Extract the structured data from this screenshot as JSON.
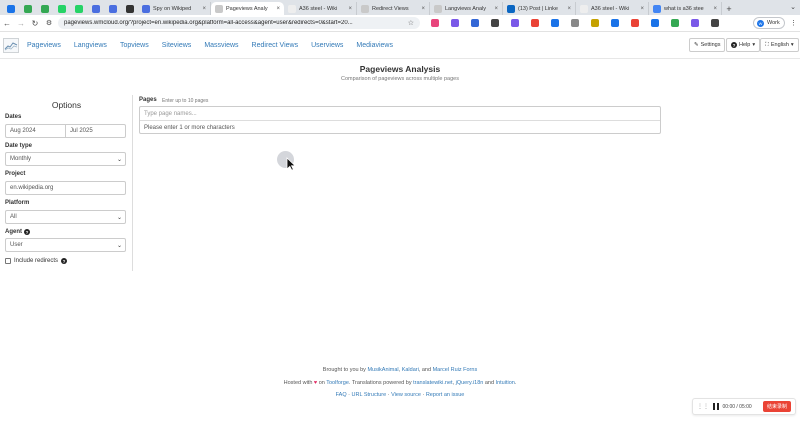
{
  "browser": {
    "tabs": [
      {
        "label": "Spy on Wikiped",
        "favicon_color": "#4a6ee0"
      },
      {
        "label": "Pageviews Analy",
        "favicon_color": "#c9c9c9",
        "active": true
      },
      {
        "label": "A36 steel - Wiki",
        "favicon_color": "#eeeeee"
      },
      {
        "label": "Redirect Views",
        "favicon_color": "#c9c9c9"
      },
      {
        "label": "Langviews Analy",
        "favicon_color": "#c9c9c9"
      },
      {
        "label": "(13) Post | Linke",
        "favicon_color": "#0a66c2"
      },
      {
        "label": "A36 steel - Wiki",
        "favicon_color": "#eeeeee"
      },
      {
        "label": "what is a36 stee",
        "favicon_color": "#4285f4"
      }
    ],
    "pinned_icons": [
      "#1a73e8",
      "#34a853",
      "#34a853",
      "#25d366",
      "#25d366",
      "#4a6ee0",
      "#4a6ee0",
      "#333333"
    ],
    "new_tab_label": "+",
    "menu_label": "⌄",
    "address": "pageviews.wmcloud.org/?project=en.wikipedia.org&platform=all-access&agent=user&redirects=0&start=20...",
    "profile_label": "Work",
    "profile_initial": "W",
    "extension_colors": [
      "#e8457c",
      "#7a59e8",
      "#3367d6",
      "#444444",
      "#7a59e8",
      "#ea4335",
      "#1a73e8",
      "#888888",
      "#c5a100",
      "#1a73e8",
      "#ea4335",
      "#1a73e8",
      "#34a853",
      "#7a59e8",
      "#444444"
    ]
  },
  "site": {
    "nav_links": [
      "Pageviews",
      "Langviews",
      "Topviews",
      "Siteviews",
      "Massviews",
      "Redirect Views",
      "Userviews",
      "Mediaviews"
    ],
    "settings_label": "Settings",
    "help_label": "Help",
    "language_label": "English"
  },
  "main": {
    "title": "Pageviews Analysis",
    "subtitle": "Comparison of pageviews across multiple pages",
    "options": {
      "heading": "Options",
      "dates_label": "Dates",
      "start_date": "Aug 2024",
      "end_date": "Jul 2025",
      "date_type_label": "Date type",
      "date_type_value": "Monthly",
      "project_label": "Project",
      "project_value": "en.wikipedia.org",
      "platform_label": "Platform",
      "platform_value": "All",
      "agent_label": "Agent",
      "agent_value": "User",
      "redirects_label": "Include redirects",
      "help_glyph": "?"
    },
    "pages": {
      "label": "Pages",
      "hint": "Enter up to 10 pages",
      "placeholder": "Type page names...",
      "message": "Please enter 1 or more characters"
    }
  },
  "footer": {
    "line1": {
      "prefix": "Brought to you by ",
      "authors": [
        "MusikAnimal",
        "Kaldari",
        "Marcel Ruiz Forns"
      ],
      "sep1": ", ",
      "sep2": ", and "
    },
    "line2": {
      "hosted": "Hosted with ",
      "heart": "♥",
      "on": " on ",
      "toolforge": "Toolforge",
      "translations": ". Translations powered by ",
      "translatewiki": "translatewiki.net",
      "jquery": "jQuery.i18n",
      "and": " and ",
      "intuition": "Intuition",
      "end": "."
    },
    "line3": {
      "faq": "FAQ",
      "url_structure": "URL Structure",
      "view_source": "View source",
      "report": "Report an issue",
      "sep": " · "
    }
  },
  "recorder": {
    "time": "00:00 / 05:00",
    "stop_label": "结束录制"
  }
}
